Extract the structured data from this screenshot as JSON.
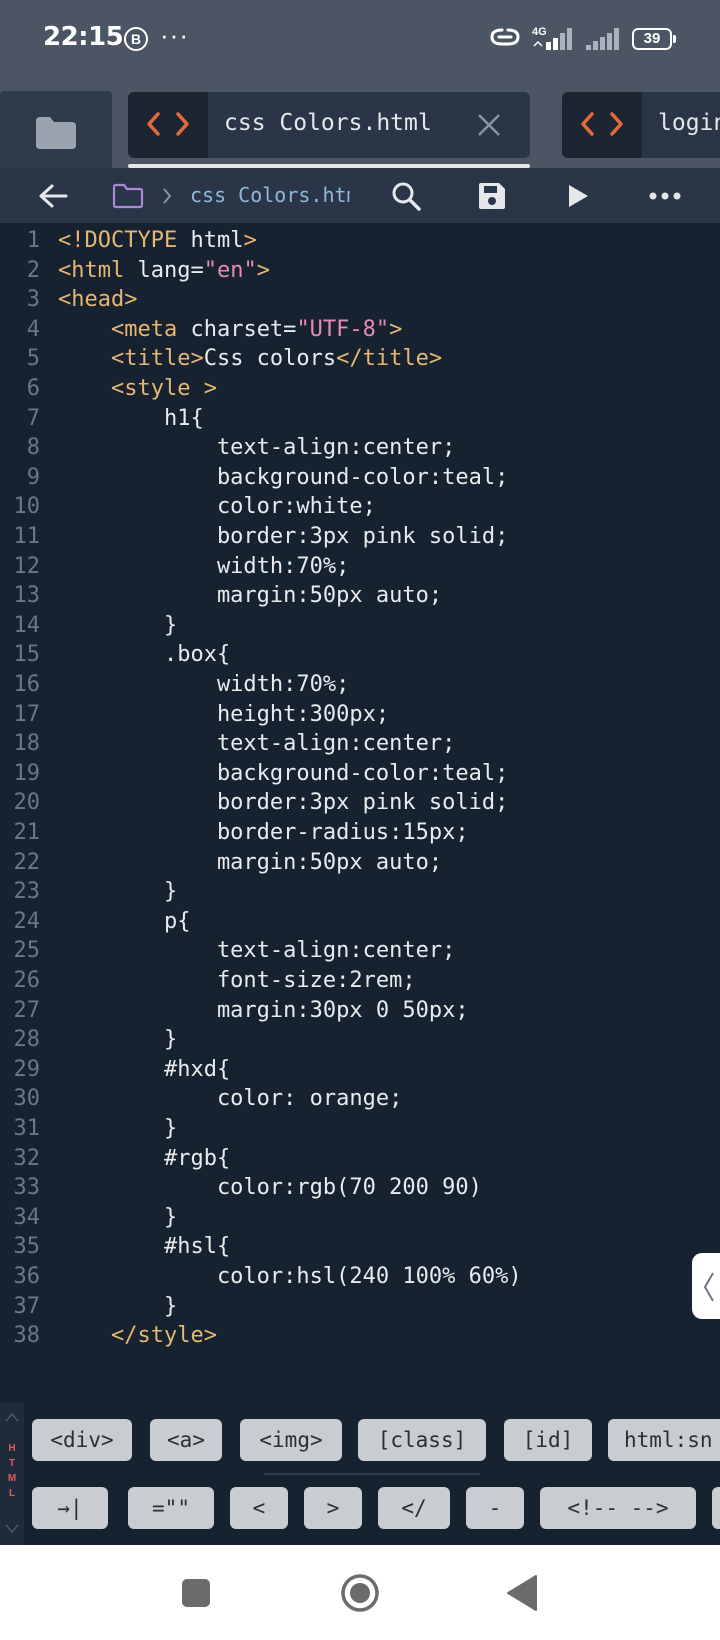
{
  "status_bar": {
    "time": "22:15",
    "b_badge": "B",
    "more": "···",
    "network": "4G",
    "battery": "39"
  },
  "tabs": [
    {
      "label": "css Colors.html",
      "active": true
    },
    {
      "label": "login",
      "active": false
    }
  ],
  "toolbar": {
    "breadcrumb": "css Colors.html"
  },
  "editor": {
    "lines": [
      [
        [
          "t",
          "<!DOCTYPE"
        ],
        [
          "p",
          " html"
        ],
        [
          "t",
          ">"
        ]
      ],
      [
        [
          "t",
          "<html"
        ],
        [
          "p",
          " lang="
        ],
        [
          "s",
          "\"en\""
        ],
        [
          "t",
          ">"
        ]
      ],
      [
        [
          "t",
          "<head>"
        ]
      ],
      [
        [
          "p",
          "    "
        ],
        [
          "t",
          "<meta"
        ],
        [
          "p",
          " charset="
        ],
        [
          "s",
          "\"UTF-8\""
        ],
        [
          "t",
          ">"
        ]
      ],
      [
        [
          "p",
          "    "
        ],
        [
          "t",
          "<title>"
        ],
        [
          "p",
          "Css colors"
        ],
        [
          "t",
          "</title>"
        ]
      ],
      [
        [
          "p",
          "    "
        ],
        [
          "t",
          "<style >"
        ]
      ],
      [
        [
          "p",
          "        h1{"
        ]
      ],
      [
        [
          "p",
          "            text-align:center;"
        ]
      ],
      [
        [
          "p",
          "            background-color:teal;"
        ]
      ],
      [
        [
          "p",
          "            color:white;"
        ]
      ],
      [
        [
          "p",
          "            border:3px pink solid;"
        ]
      ],
      [
        [
          "p",
          "            width:70%;"
        ]
      ],
      [
        [
          "p",
          "            margin:50px auto;"
        ]
      ],
      [
        [
          "p",
          "        }"
        ]
      ],
      [
        [
          "p",
          "        .box{"
        ]
      ],
      [
        [
          "p",
          "            width:70%;"
        ]
      ],
      [
        [
          "p",
          "            height:300px;"
        ]
      ],
      [
        [
          "p",
          "            text-align:center;"
        ]
      ],
      [
        [
          "p",
          "            background-color:teal;"
        ]
      ],
      [
        [
          "p",
          "            border:3px pink solid;"
        ]
      ],
      [
        [
          "p",
          "            border-radius:15px;"
        ]
      ],
      [
        [
          "p",
          "            margin:50px auto;"
        ]
      ],
      [
        [
          "p",
          "        }"
        ]
      ],
      [
        [
          "p",
          "        p{"
        ]
      ],
      [
        [
          "p",
          "            text-align:center;"
        ]
      ],
      [
        [
          "p",
          "            font-size:2rem;"
        ]
      ],
      [
        [
          "p",
          "            margin:30px 0 50px;"
        ]
      ],
      [
        [
          "p",
          "        }"
        ]
      ],
      [
        [
          "p",
          "        #hxd{"
        ]
      ],
      [
        [
          "p",
          "            color: orange;"
        ]
      ],
      [
        [
          "p",
          "        }"
        ]
      ],
      [
        [
          "p",
          "        #rgb{"
        ]
      ],
      [
        [
          "p",
          "            color:rgb(70 200 90)"
        ]
      ],
      [
        [
          "p",
          "        }"
        ]
      ],
      [
        [
          "p",
          "        #hsl{"
        ]
      ],
      [
        [
          "p",
          "            color:hsl(240 100% 60%)"
        ]
      ],
      [
        [
          "p",
          "        }"
        ]
      ],
      [
        [
          "p",
          "    "
        ],
        [
          "t",
          "</style>"
        ]
      ]
    ]
  },
  "snippets": {
    "side_label": [
      "H",
      "T",
      "M",
      "L"
    ],
    "row1": [
      "<div>",
      "<a>",
      "<img>",
      "[class]",
      "[id]",
      "html:sn"
    ],
    "row2": [
      "→|",
      "=\"\"",
      "<",
      ">",
      "</",
      "-",
      "<!-- -->"
    ]
  },
  "colors": {
    "tag": "#e6b673",
    "string": "#e98ab4",
    "plain": "#e8eaed",
    "accent": "#e8673c",
    "editor_bg": "#162230"
  }
}
